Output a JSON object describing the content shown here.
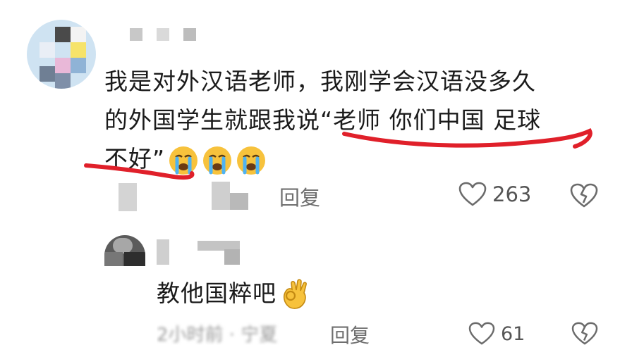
{
  "comment": {
    "avatar_icon": "avatar-icon",
    "text_line1": "我是对外汉语老师，我刚学会汉语没多久",
    "text_line2": "的外国学生就跟我说“老师 你们中国 足球",
    "text_line3": "不好”",
    "emojis": [
      "crying-face-icon",
      "crying-face-icon",
      "crying-face-icon"
    ],
    "reply_label": "回复",
    "like_count": "263",
    "like_icon": "heart-icon",
    "dislike_icon": "broken-heart-icon"
  },
  "reply": {
    "avatar_icon": "avatar-icon",
    "text": "教他国粹吧",
    "emoji": "ok-hand-icon",
    "time_label": "2小时前 · 宁夏",
    "reply_label": "回复",
    "like_count": "61",
    "like_icon": "heart-icon",
    "dislike_icon": "broken-heart-icon"
  },
  "colors": {
    "annotation_red": "#e0202a",
    "text_primary": "#1b1b1b",
    "text_secondary": "#6f6f6f"
  }
}
